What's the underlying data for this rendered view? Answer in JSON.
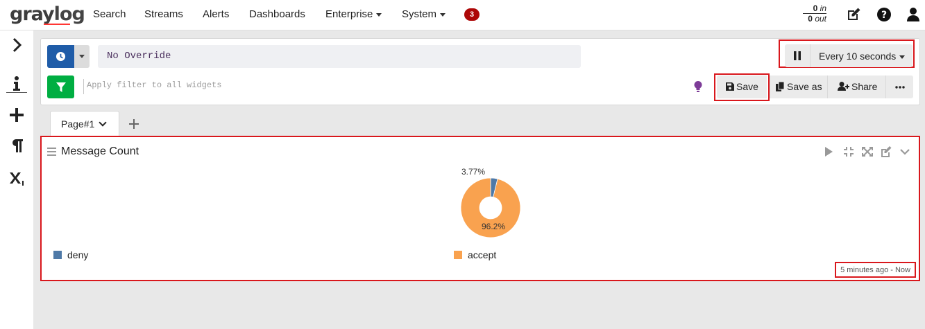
{
  "brand": {
    "logo_text_a": "gray",
    "logo_text_b": "log"
  },
  "nav": {
    "items": [
      "Search",
      "Streams",
      "Alerts",
      "Dashboards",
      "Enterprise",
      "System"
    ],
    "notification_count": "3"
  },
  "throughput": {
    "in_value": "0",
    "in_label": "in",
    "out_value": "0",
    "out_label": "out"
  },
  "query": {
    "time_override": "No Override",
    "filter_placeholder": "Apply filter to all widgets",
    "refresh_label": "Every 10 seconds"
  },
  "actions": {
    "save": "Save",
    "save_as": "Save as",
    "share": "Share"
  },
  "tabs": {
    "page_label": "Page#1"
  },
  "widget": {
    "title": "Message Count",
    "timerange": "5 minutes ago - Now",
    "chart_data": {
      "type": "pie",
      "donut": true,
      "categories": [
        "deny",
        "accept"
      ],
      "values": [
        3.77,
        96.2
      ],
      "labels": [
        "3.77%",
        "96.2%"
      ],
      "colors": [
        "#4e79a7",
        "#f9a24f"
      ],
      "legend": "bottom"
    }
  },
  "colors": {
    "accent_red": "#d9171c",
    "primary_blue": "#1f5ca8",
    "success_green": "#00ae42",
    "badge_red": "#ad0707"
  }
}
